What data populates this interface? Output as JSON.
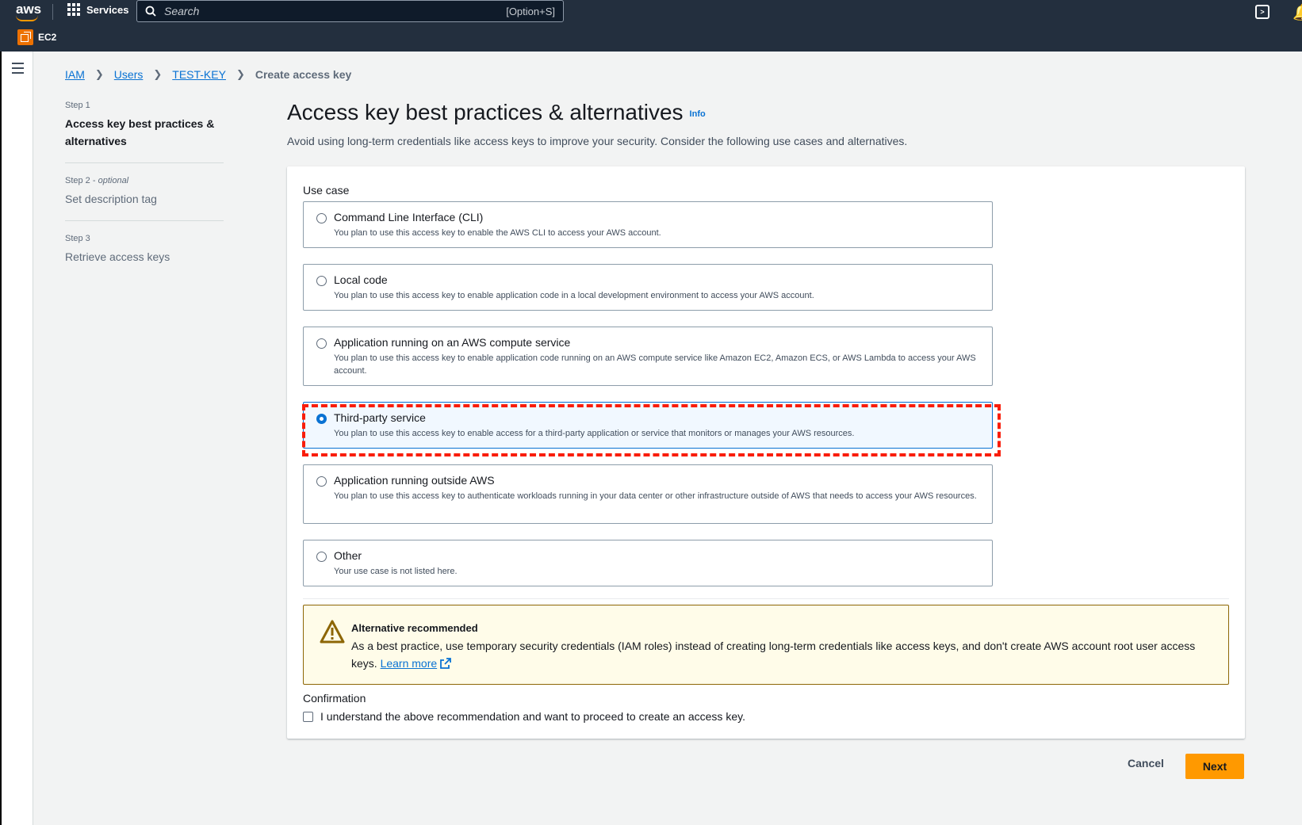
{
  "topnav": {
    "logo": "aws",
    "services_label": "Services",
    "search_placeholder": "Search",
    "search_shortcut": "[Option+S]",
    "service_chip": "EC2"
  },
  "breadcrumb": [
    {
      "label": "IAM"
    },
    {
      "label": "Users"
    },
    {
      "label": "TEST-KEY"
    },
    {
      "label": "Create access key"
    }
  ],
  "steps": [
    {
      "num": "Step 1",
      "optional": "",
      "label": "Access key best practices & alternatives",
      "active": true
    },
    {
      "num": "Step 2",
      "optional": "optional",
      "label": "Set description tag",
      "active": false
    },
    {
      "num": "Step 3",
      "optional": "",
      "label": "Retrieve access keys",
      "active": false
    }
  ],
  "page": {
    "title": "Access key best practices & alternatives",
    "info": "Info",
    "subtitle": "Avoid using long-term credentials like access keys to improve your security. Consider the following use cases and alternatives."
  },
  "use_case": {
    "label": "Use case",
    "selected": "Third-party service",
    "options": [
      {
        "title": "Command Line Interface (CLI)",
        "desc": "You plan to use this access key to enable the AWS CLI to access your AWS account."
      },
      {
        "title": "Local code",
        "desc": "You plan to use this access key to enable application code in a local development environment to access your AWS account."
      },
      {
        "title": "Application running on an AWS compute service",
        "desc": "You plan to use this access key to enable application code running on an AWS compute service like Amazon EC2, Amazon ECS, or AWS Lambda to access your AWS account."
      },
      {
        "title": "Third-party service",
        "desc": "You plan to use this access key to enable access for a third-party application or service that monitors or manages your AWS resources."
      },
      {
        "title": "Application running outside AWS",
        "desc": "You plan to use this access key to authenticate workloads running in your data center or other infrastructure outside of AWS that needs to access your AWS resources."
      },
      {
        "title": "Other",
        "desc": "Your use case is not listed here."
      }
    ]
  },
  "alert": {
    "title": "Alternative recommended",
    "body": "As a best practice, use temporary security credentials (IAM roles) instead of creating long-term credentials like access keys, and don't create AWS account root user access keys.",
    "link": "Learn more"
  },
  "confirmation": {
    "label": "Confirmation",
    "checkbox_text": "I understand the above recommendation and want to proceed to create an access key.",
    "checked": false
  },
  "actions": {
    "cancel": "Cancel",
    "next": "Next"
  },
  "colors": {
    "nav_bg": "#232f3e",
    "primary_button": "#ff9900",
    "link": "#0972d3",
    "highlight": "#f91d0a",
    "alert_bg": "#fffce9"
  }
}
